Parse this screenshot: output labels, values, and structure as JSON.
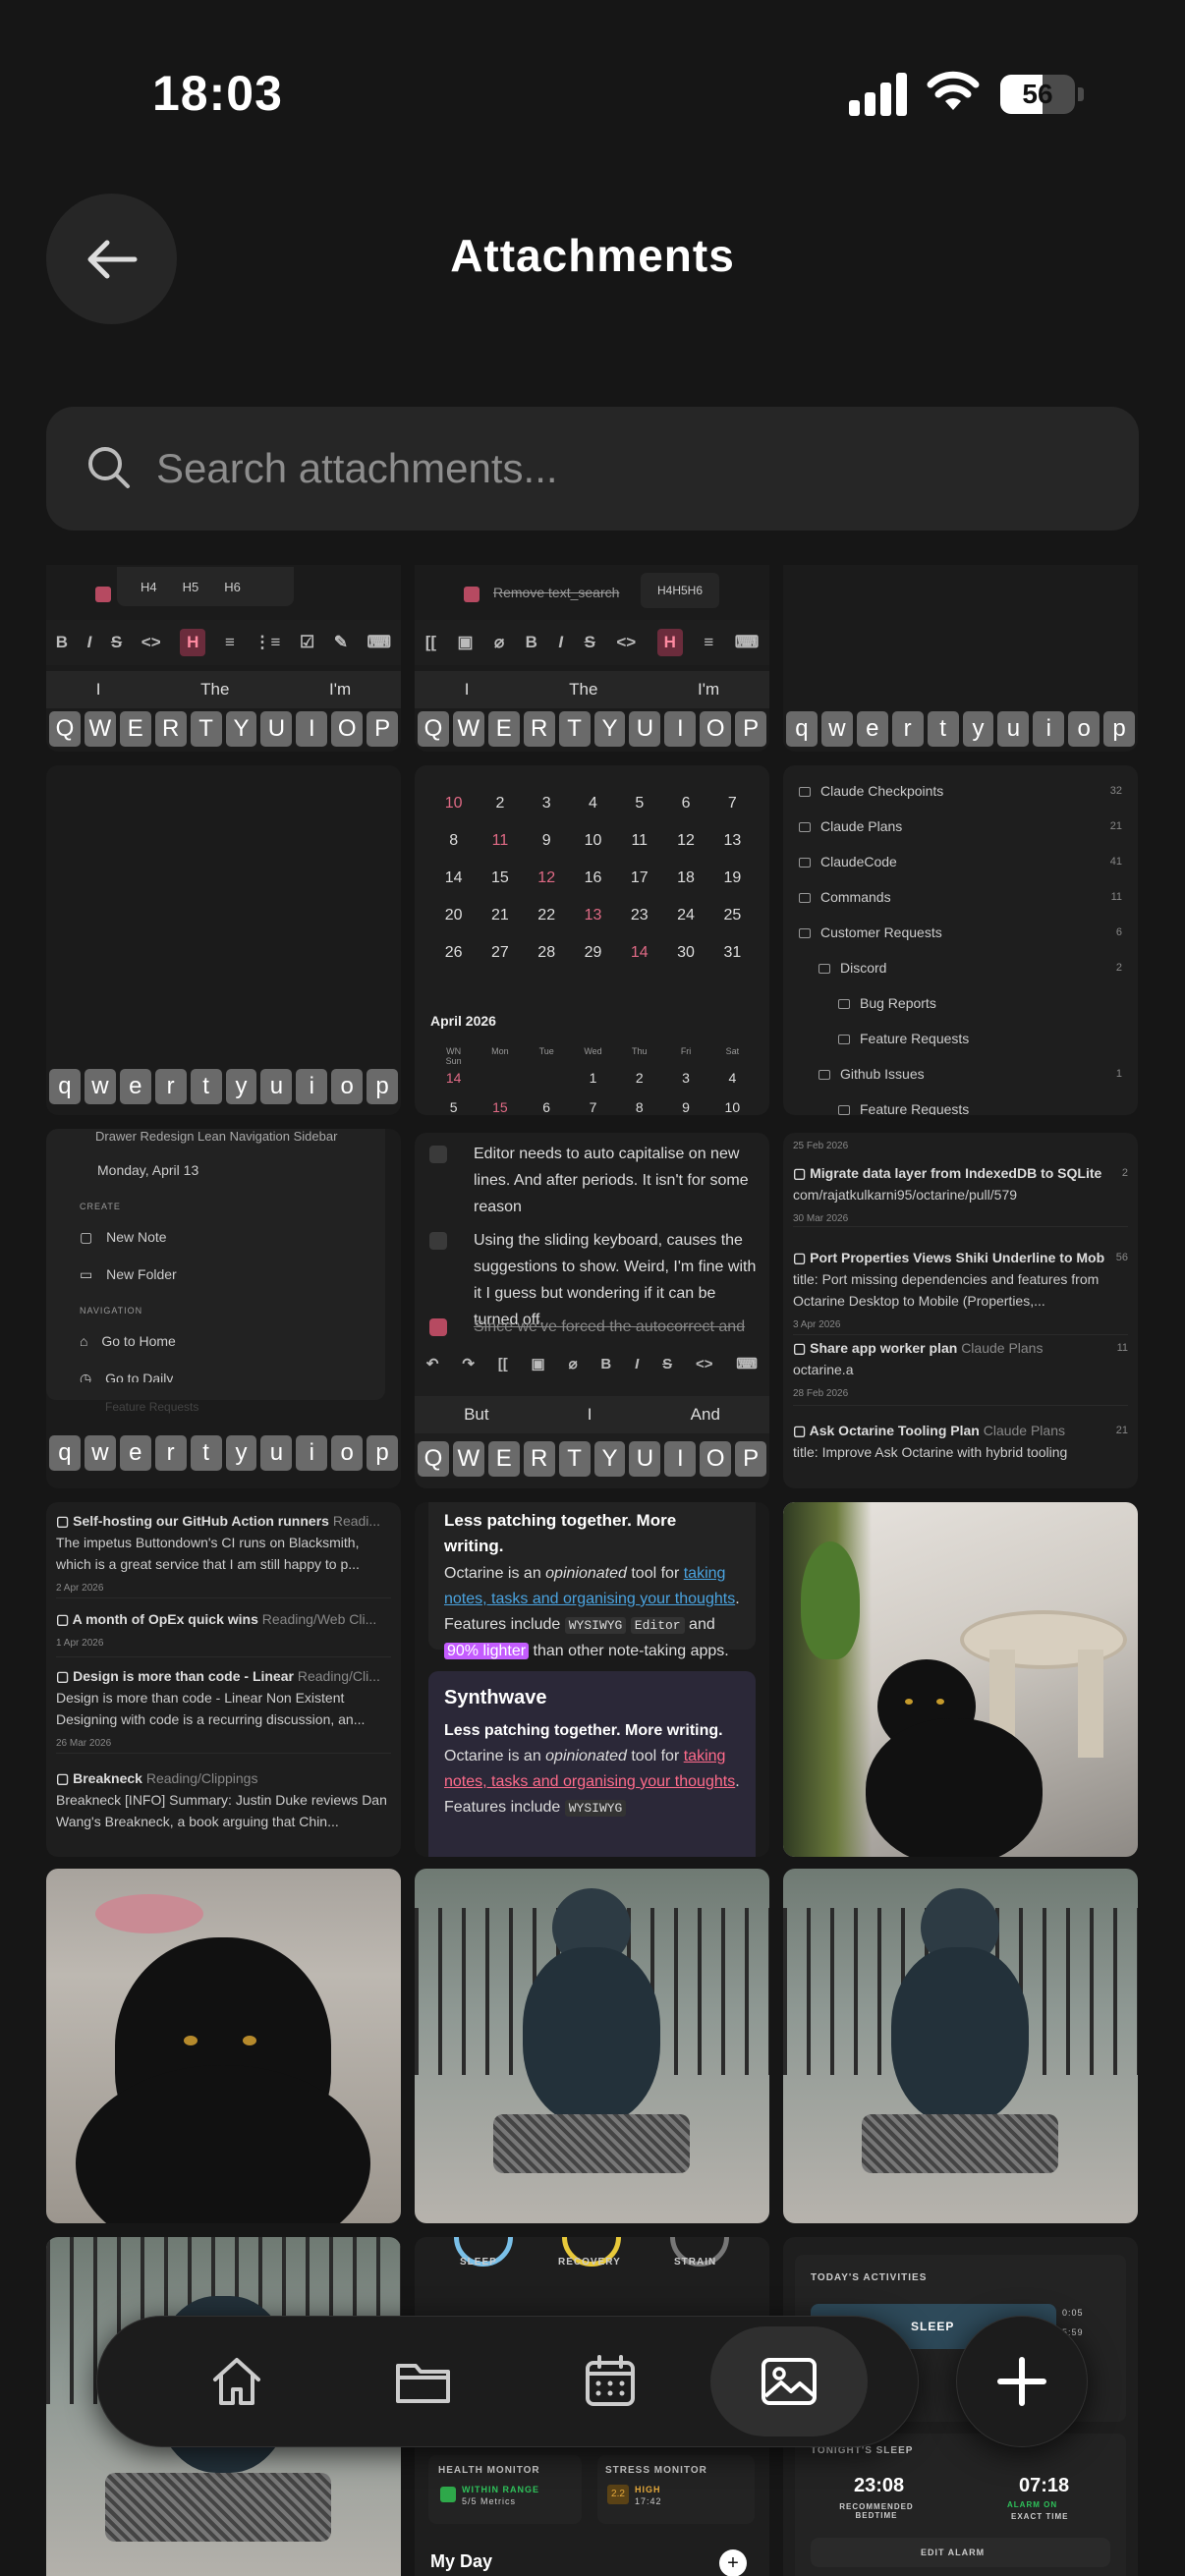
{
  "status_bar": {
    "time": "18:03",
    "battery": "56",
    "battery_level": 0.56
  },
  "header": {
    "title": "Attachments"
  },
  "search": {
    "placeholder": "Search attachments..."
  },
  "attachments": {
    "tile1": {
      "heading_opts": [
        "H4",
        "H5",
        "H6"
      ],
      "suggestions": [
        "I",
        "The",
        "I'm"
      ],
      "keys": [
        "Q",
        "W",
        "E",
        "R",
        "T",
        "Y",
        "U",
        "I",
        "O",
        "P"
      ]
    },
    "tile2": {
      "heading_opts": "H4H5H6",
      "task": "Remove text_search",
      "suggestions": [
        "I",
        "The",
        "I'm"
      ],
      "keys": [
        "Q",
        "W",
        "E",
        "R",
        "T",
        "Y",
        "U",
        "I",
        "O",
        "P"
      ]
    },
    "tile3": {
      "keys": [
        "q",
        "w",
        "e",
        "r",
        "t",
        "y",
        "u",
        "i",
        "o",
        "p"
      ]
    },
    "tile4": {
      "keys": [
        "q",
        "w",
        "e",
        "r",
        "t",
        "y",
        "u",
        "i",
        "o",
        "p"
      ]
    },
    "calendar": {
      "rows": [
        [
          "10",
          "2",
          "3",
          "4",
          "5",
          "6",
          "7",
          "8"
        ],
        [
          "11",
          "9",
          "10",
          "11",
          "12",
          "13",
          "14",
          "15"
        ],
        [
          "12",
          "16",
          "17",
          "18",
          "19",
          "20",
          "21",
          "22"
        ],
        [
          "13",
          "23",
          "24",
          "25",
          "26",
          "27",
          "28",
          "29"
        ],
        [
          "14",
          "30",
          "31",
          "",
          "",
          "",
          "",
          ""
        ]
      ],
      "month2": "April 2026",
      "headers": [
        "WN",
        "Mon",
        "Tue",
        "Wed",
        "Thu",
        "Fri",
        "Sat",
        "Sun"
      ],
      "rows2": [
        [
          "14",
          "",
          "",
          "1",
          "2",
          "3",
          "4",
          "5"
        ],
        [
          "15",
          "6",
          "7",
          "8",
          "9",
          "10",
          "11",
          "12"
        ]
      ]
    },
    "folders": [
      {
        "name": "Claude Checkpoints",
        "count": "32"
      },
      {
        "name": "Claude Plans",
        "count": "21"
      },
      {
        "name": "ClaudeCode",
        "count": "41"
      },
      {
        "name": "Commands",
        "count": "11"
      },
      {
        "name": "Customer Requests",
        "count": "6"
      },
      {
        "name": "Discord",
        "count": "2"
      },
      {
        "name": "Bug Reports",
        "count": ""
      },
      {
        "name": "Feature Requests",
        "count": ""
      },
      {
        "name": "Github Issues",
        "count": "1"
      },
      {
        "name": "Feature Requests",
        "count": ""
      }
    ],
    "menu": {
      "top": "Drawer Redesign Lean Navigation Sidebar",
      "date": "Monday, April 13",
      "create_label": "CREATE",
      "new_note": "New Note",
      "new_folder": "New Folder",
      "nav_label": "NAVIGATION",
      "go_home": "Go to Home",
      "cut": "Go to Daily",
      "faded": "Feature Requests",
      "keys": [
        "q",
        "w",
        "e",
        "r",
        "t",
        "y",
        "u",
        "i",
        "o",
        "p"
      ]
    },
    "tasks": {
      "t1": "Editor needs to auto capitalise on new lines. And after periods. It isn't for some reason",
      "t2": "Using the sliding keyboard, causes the suggestions to show. Weird, I'm fine with it I guess but wondering if it can be turned off.",
      "t3": "Since we've forced the autocorrect and",
      "suggestions": [
        "But",
        "I",
        "And"
      ],
      "keys": [
        "Q",
        "W",
        "E",
        "R",
        "T",
        "Y",
        "U",
        "I",
        "O",
        "P"
      ]
    },
    "plans": [
      {
        "date_top": "25 Feb 2026"
      },
      {
        "title": "Migrate data layer from IndexedDB to SQLite",
        "count": "2",
        "body": "com/rajatkulkarni95/octarine/pull/579",
        "date": "30 Mar 2026"
      },
      {
        "title": "Port Properties Views Shiki Underline to Mob",
        "count": "56",
        "body": "title: Port missing dependencies and features from Octarine Desktop to Mobile (Properties,...",
        "date": "3 Apr 2026"
      },
      {
        "title": "Share app worker plan",
        "sub": "Claude Plans",
        "count": "11",
        "body": "octarine.a",
        "date": "28 Feb 2026"
      },
      {
        "title": "Ask Octarine Tooling Plan",
        "sub": "Claude Plans",
        "count": "21",
        "body": "title: Improve Ask Octarine with hybrid tooling"
      }
    ],
    "reading": [
      {
        "title": "Self-hosting our GitHub Action runners",
        "sub": "Readi...",
        "body": "The impetus Buttondown's CI runs on Blacksmith, which is a great service that I am still happy to p...",
        "date": "2 Apr 2026"
      },
      {
        "title": "A month of OpEx quick wins",
        "sub": "Reading/Web Cli...",
        "date": "1 Apr 2026"
      },
      {
        "title": "Design is more than code - Linear",
        "sub": "Reading/Cli...",
        "body": "Design is more than code - Linear Non Existent Designing with code is a recurring discussion, an...",
        "date": "26 Mar 2026"
      },
      {
        "title": "Breakneck",
        "sub": "Reading/Clippings",
        "body": "Breakneck [INFO] Summary: Justin Duke reviews Dan Wang's Breakneck, a book arguing that Chin..."
      }
    ],
    "themes": {
      "heading": "Less patching together. More writing.",
      "p1": "Octarine is an ",
      "em": "opinionated",
      "p2": " tool for ",
      "link": "taking notes, tasks and organising your thoughts",
      "p3": ". Features include ",
      "code1": "WYSIWYG",
      "code2": "Editor",
      "and": " and ",
      "hl": "90% lighter",
      "p4": " than other note-taking apps.",
      "syn_title": "Synthwave",
      "syn_p3": ". Features include ",
      "syn_code": "WYSIWYG"
    },
    "health": {
      "sleep": "SLEEP",
      "recovery": "RECOVERY",
      "strain": "STRAIN",
      "hm": "HEALTH MONITOR",
      "within": "WITHIN RANGE",
      "metrics": "5/5 Metrics",
      "sm": "STRESS MONITOR",
      "sm_val": "2.2",
      "high": "HIGH",
      "high_time": "17:42",
      "my_day": "My Day"
    },
    "activities": {
      "title": "TODAY'S ACTIVITIES",
      "sleep": "SLEEP",
      "t1": "0:05",
      "t2": "5:59",
      "tonight": "TONIGHT'S SLEEP",
      "bed": "23:08",
      "bed_label": "RECOMMENDED BEDTIME",
      "alarm": "07:18",
      "alarm_on": "ALARM ON",
      "alarm_label": "EXACT TIME",
      "edit": "EDIT ALARM"
    }
  },
  "tabbar": {
    "items": [
      "home-icon",
      "folder-icon",
      "calendar-icon",
      "image-icon"
    ],
    "active": "image-icon"
  }
}
